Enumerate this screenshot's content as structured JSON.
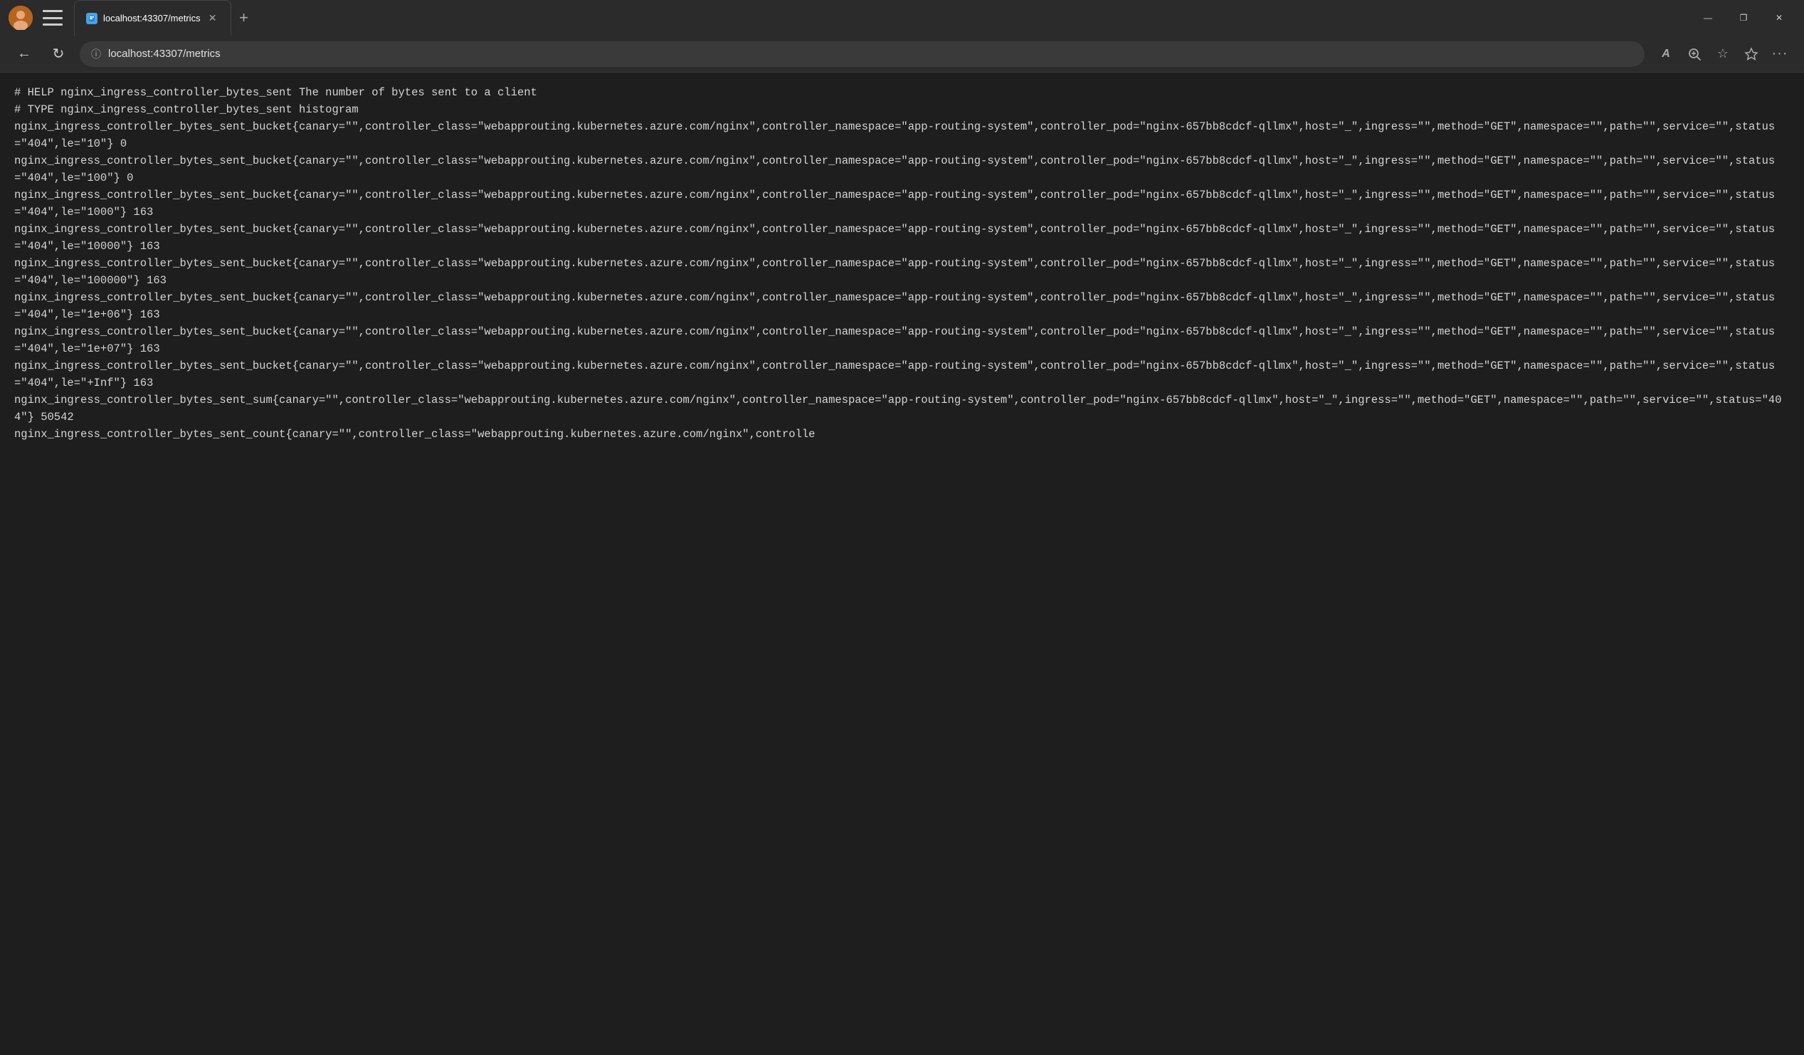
{
  "titlebar": {
    "tab_title": "localhost:43307/metrics",
    "new_tab_label": "+",
    "win_minimize": "—",
    "win_restore": "❐",
    "win_close": "✕"
  },
  "addressbar": {
    "url": "localhost:43307/metrics",
    "back_icon": "←",
    "reload_icon": "↻",
    "lock_icon": "ⓘ",
    "read_icon": "𝐴",
    "zoom_icon": "⊕",
    "star_icon": "☆",
    "favstar_icon": "⭐",
    "more_icon": "···"
  },
  "content": {
    "lines": [
      "# HELP nginx_ingress_controller_bytes_sent The number of bytes sent to a client",
      "# TYPE nginx_ingress_controller_bytes_sent histogram",
      "nginx_ingress_controller_bytes_sent_bucket{canary=\"\",controller_class=\"webapprouting.kubernetes.azure.com/nginx\",controller_namespace=\"app-routing-system\",controller_pod=\"nginx-657bb8cdcf-qllmx\",host=\"_\",ingress=\"\",method=\"GET\",namespace=\"\",path=\"\",service=\"\",status=\"404\",le=\"10\"} 0",
      "nginx_ingress_controller_bytes_sent_bucket{canary=\"\",controller_class=\"webapprouting.kubernetes.azure.com/nginx\",controller_namespace=\"app-routing-system\",controller_pod=\"nginx-657bb8cdcf-qllmx\",host=\"_\",ingress=\"\",method=\"GET\",namespace=\"\",path=\"\",service=\"\",status=\"404\",le=\"100\"} 0",
      "nginx_ingress_controller_bytes_sent_bucket{canary=\"\",controller_class=\"webapprouting.kubernetes.azure.com/nginx\",controller_namespace=\"app-routing-system\",controller_pod=\"nginx-657bb8cdcf-qllmx\",host=\"_\",ingress=\"\",method=\"GET\",namespace=\"\",path=\"\",service=\"\",status=\"404\",le=\"1000\"} 163",
      "nginx_ingress_controller_bytes_sent_bucket{canary=\"\",controller_class=\"webapprouting.kubernetes.azure.com/nginx\",controller_namespace=\"app-routing-system\",controller_pod=\"nginx-657bb8cdcf-qllmx\",host=\"_\",ingress=\"\",method=\"GET\",namespace=\"\",path=\"\",service=\"\",status=\"404\",le=\"10000\"} 163",
      "nginx_ingress_controller_bytes_sent_bucket{canary=\"\",controller_class=\"webapprouting.kubernetes.azure.com/nginx\",controller_namespace=\"app-routing-system\",controller_pod=\"nginx-657bb8cdcf-qllmx\",host=\"_\",ingress=\"\",method=\"GET\",namespace=\"\",path=\"\",service=\"\",status=\"404\",le=\"100000\"} 163",
      "nginx_ingress_controller_bytes_sent_bucket{canary=\"\",controller_class=\"webapprouting.kubernetes.azure.com/nginx\",controller_namespace=\"app-routing-system\",controller_pod=\"nginx-657bb8cdcf-qllmx\",host=\"_\",ingress=\"\",method=\"GET\",namespace=\"\",path=\"\",service=\"\",status=\"404\",le=\"1e+06\"} 163",
      "nginx_ingress_controller_bytes_sent_bucket{canary=\"\",controller_class=\"webapprouting.kubernetes.azure.com/nginx\",controller_namespace=\"app-routing-system\",controller_pod=\"nginx-657bb8cdcf-qllmx\",host=\"_\",ingress=\"\",method=\"GET\",namespace=\"\",path=\"\",service=\"\",status=\"404\",le=\"1e+07\"} 163",
      "nginx_ingress_controller_bytes_sent_bucket{canary=\"\",controller_class=\"webapprouting.kubernetes.azure.com/nginx\",controller_namespace=\"app-routing-system\",controller_pod=\"nginx-657bb8cdcf-qllmx\",host=\"_\",ingress=\"\",method=\"GET\",namespace=\"\",path=\"\",service=\"\",status=\"404\",le=\"+Inf\"} 163",
      "nginx_ingress_controller_bytes_sent_sum{canary=\"\",controller_class=\"webapprouting.kubernetes.azure.com/nginx\",controller_namespace=\"app-routing-system\",controller_pod=\"nginx-657bb8cdcf-qllmx\",host=\"_\",ingress=\"\",method=\"GET\",namespace=\"\",path=\"\",service=\"\",status=\"404\"} 50542",
      "nginx_ingress_controller_bytes_sent_count{canary=\"\",controller_class=\"webapprouting.kubernetes.azure.com/nginx\",controlle"
    ]
  }
}
